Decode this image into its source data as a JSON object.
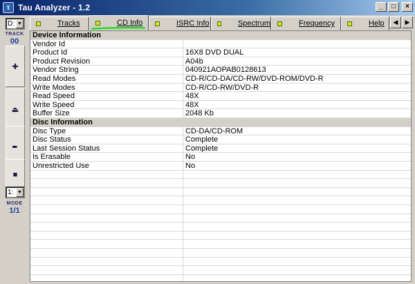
{
  "window": {
    "title": "Tau Analyzer - 1.2"
  },
  "leftbar": {
    "drive_value": "D:",
    "track_label": "TRACK",
    "track_value": "00",
    "mode_select_value": "1:",
    "mode_label": "MODE",
    "mode_value": "1/1",
    "buttons": [
      "add",
      "eject",
      "next",
      "stop"
    ]
  },
  "tabs": [
    {
      "label": "Tracks",
      "active": false
    },
    {
      "label": "CD Info",
      "active": true
    },
    {
      "label": "ISRC Info",
      "active": false
    },
    {
      "label": "Spectrum",
      "active": false
    },
    {
      "label": "Frequency",
      "active": false
    },
    {
      "label": "Help",
      "active": false
    }
  ],
  "sections": [
    {
      "title": "Device Information",
      "rows": [
        [
          "Vendor Id",
          ""
        ],
        [
          "Product Id",
          "16X8 DVD DUAL"
        ],
        [
          "Product Revision",
          "A04b"
        ],
        [
          "Vendor String",
          "040921AOPAB0128613"
        ],
        [
          "Read Modes",
          "CD-R/CD-DA/CD-RW/DVD-ROM/DVD-R"
        ],
        [
          "Write Modes",
          "CD-R/CD-RW/DVD-R"
        ],
        [
          "Read Speed",
          "48X"
        ],
        [
          "Write Speed",
          "48X"
        ],
        [
          "Buffer Size",
          "2048 Kb"
        ]
      ]
    },
    {
      "title": "Disc Information",
      "rows": [
        [
          "Disc Type",
          "CD-DA/CD-ROM"
        ],
        [
          "Disc Status",
          "Complete"
        ],
        [
          "Last Session Status",
          "Complete"
        ],
        [
          "Is Erasable",
          "No"
        ],
        [
          "Unrestricted Use",
          "No"
        ]
      ]
    }
  ],
  "empty_rows": 13,
  "colors": {
    "titlebar": "#0a246a",
    "tab_indicator": "#c8e830",
    "annotation": "#22dd22",
    "side_value": "#1d3c9a"
  }
}
